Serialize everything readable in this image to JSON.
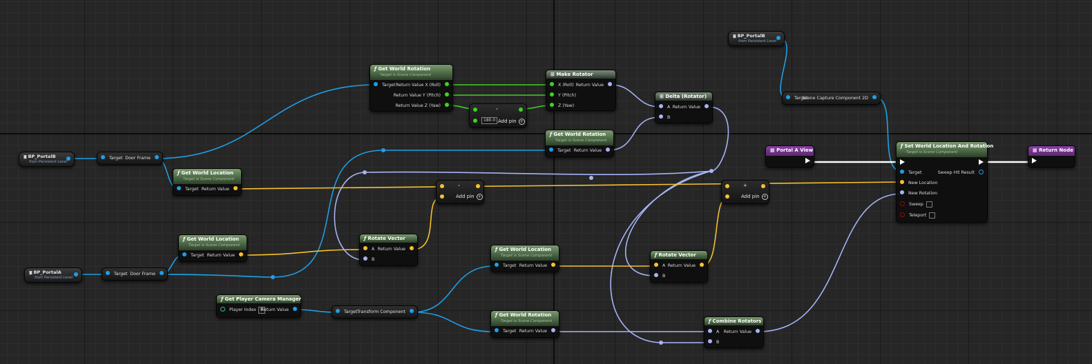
{
  "colors": {
    "object": "#1f9fe6",
    "vector": "#f7c12e",
    "rotator": "#a6b4f5",
    "float": "#3ed31f",
    "exec": "#ffffff",
    "function_header": "#4c6a46",
    "event_header": "#5b2a70"
  },
  "refs": {
    "portal_b_top": {
      "label": "BP_PortalB",
      "sub": "from Persistent Level"
    },
    "portal_b_left": {
      "label": "BP_PortalB",
      "sub": "from Persistent Level"
    },
    "portal_a": {
      "label": "BP_PortalA",
      "sub": "from Persistent Level"
    }
  },
  "nodes": {
    "doorframe_b": {
      "in": "Target",
      "out": "Door Frame"
    },
    "doorframe_a": {
      "in": "Target",
      "out": "Door Frame"
    },
    "get_world_rotation_top": {
      "title": "Get World Rotation",
      "sub": "Target is Scene Component",
      "in": "Target",
      "out_x": "Return Value X (Roll)",
      "out_y": "Return Value Y (Pitch)",
      "out_z": "Return Value Z (Yaw)"
    },
    "make_rotator": {
      "title": "Make Rotator",
      "x": "X (Roll)",
      "y": "Y (Pitch)",
      "z": "Z (Yaw)",
      "out": "Return Value"
    },
    "add_float": {
      "sym": "-",
      "value": "180.0",
      "add_pin": "Add pin"
    },
    "delta_rotator": {
      "title": "Delta (Rotator)",
      "a": "A",
      "b": "B",
      "out": "Return Value"
    },
    "get_world_rotation_mid": {
      "title": "Get World Rotation",
      "sub": "Target is Scene Component",
      "in": "Target",
      "out": "Return Value"
    },
    "get_world_location_b": {
      "title": "Get World Location",
      "sub": "Target is Scene Component",
      "in": "Target",
      "out": "Return Value"
    },
    "vector_sub": {
      "sym": "-",
      "add_pin": "Add pin"
    },
    "vector_add": {
      "sym": "+",
      "add_pin": "Add pin"
    },
    "get_world_location_a": {
      "title": "Get World Location",
      "sub": "Target is Scene Component",
      "in": "Target",
      "out": "Return Value"
    },
    "rotate_vector_left": {
      "title": "Rotate Vector",
      "a": "A",
      "b": "B",
      "out": "Return Value"
    },
    "get_world_location_cam": {
      "title": "Get World Location",
      "sub": "Target is Scene Component",
      "in": "Target",
      "out": "Return Value"
    },
    "rotate_vector_right": {
      "title": "Rotate Vector",
      "a": "A",
      "b": "B",
      "out": "Return Value"
    },
    "get_player_camera_manager": {
      "title": "Get Player Camera Manager",
      "in": "Player Index",
      "index_value": "0",
      "out": "Return Value"
    },
    "transform_component": {
      "in": "Target",
      "out": "Transform Component"
    },
    "get_world_rotation_cam": {
      "title": "Get World Rotation",
      "sub": "Target is Scene Component",
      "in": "Target",
      "out": "Return Value"
    },
    "combine_rotators": {
      "title": "Combine Rotators",
      "a": "A",
      "b": "B",
      "out": "Return Value"
    },
    "scene_capture": {
      "in": "Target",
      "out": "Scene Capture Component 2D"
    },
    "portal_a_view": {
      "title": "Portal A View"
    },
    "set_world_location_rotation": {
      "title": "Set World Location And Rotation",
      "sub": "Target is Scene Component",
      "target": "Target",
      "new_location": "New Location",
      "new_rotation": "New Rotation",
      "sweep": "Sweep",
      "teleport": "Teleport",
      "sweep_hit": "Sweep Hit Result"
    },
    "return_node": {
      "title": "Return Node"
    }
  }
}
